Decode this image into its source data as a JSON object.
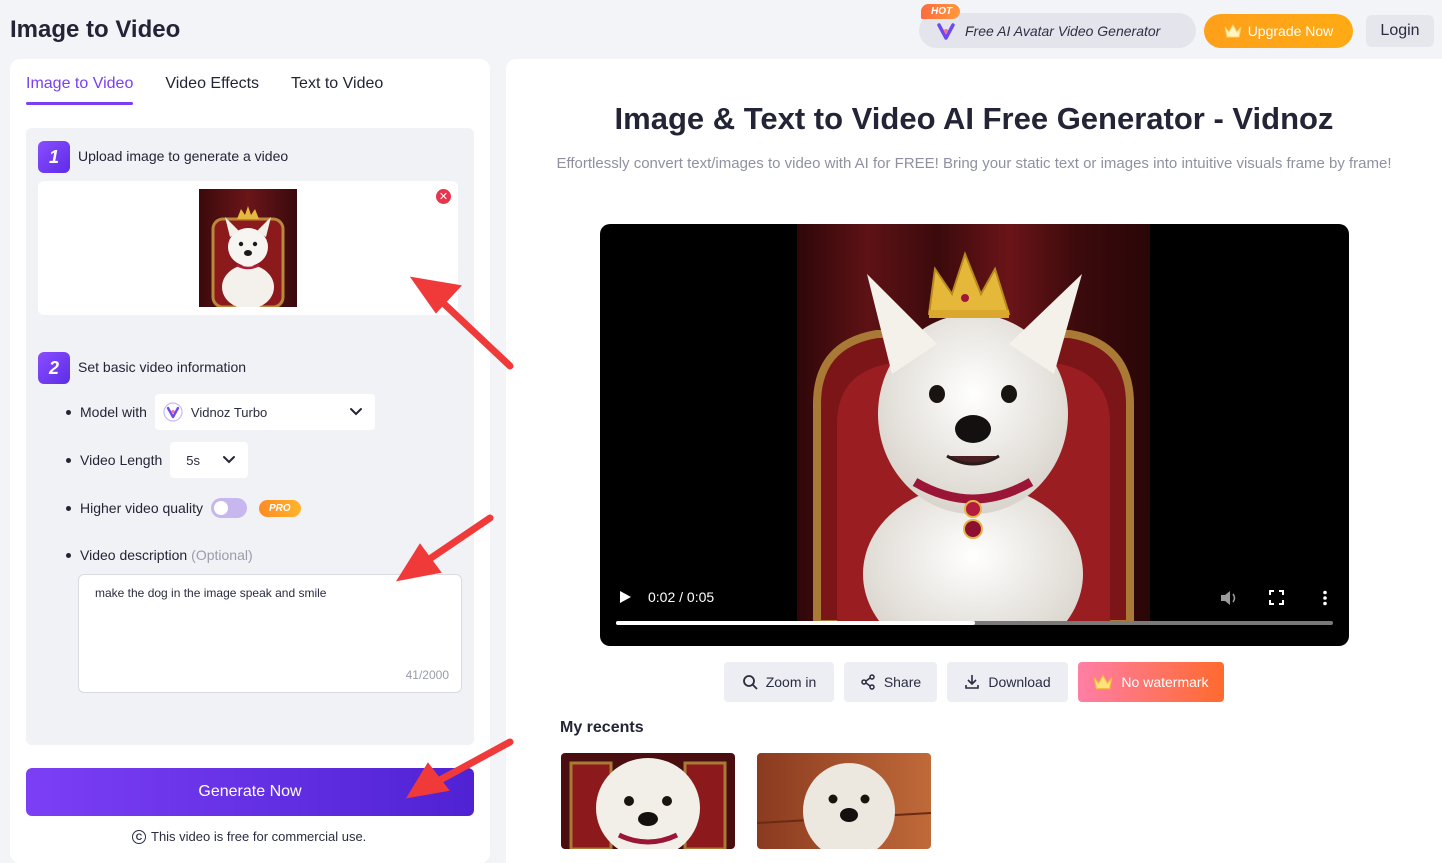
{
  "header": {
    "app_title": "Image to Video",
    "hot_badge": "HOT",
    "avatar_generator_label": "Free AI Avatar Video Generator",
    "upgrade_label": "Upgrade Now",
    "login_label": "Login"
  },
  "tabs": [
    {
      "label": "Image to Video",
      "active": true
    },
    {
      "label": "Video Effects",
      "active": false
    },
    {
      "label": "Text to Video",
      "active": false
    }
  ],
  "step1": {
    "number": "1",
    "label": "Upload image to generate a video"
  },
  "step2": {
    "number": "2",
    "label": "Set basic video information",
    "model_label": "Model with",
    "model_value": "Vidnoz Turbo",
    "length_label": "Video Length",
    "length_value": "5s",
    "quality_label": "Higher video quality",
    "quality_enabled": false,
    "pro_badge": "PRO",
    "description_label": "Video description",
    "description_optional": "(Optional)",
    "description_value": "make the dog in the image speak and smile",
    "description_count": "41/2000"
  },
  "generate_label": "Generate Now",
  "commercial_note": "This video is free for commercial use.",
  "main": {
    "title": "Image & Text to Video AI Free Generator - Vidnoz",
    "subtitle": "Effortlessly convert text/images to video with AI for FREE! Bring your static text or images into intuitive visuals frame by frame!"
  },
  "player": {
    "time": "0:02 / 0:05",
    "progress": 0.5
  },
  "actions": {
    "zoom": "Zoom in",
    "share": "Share",
    "download": "Download",
    "no_watermark": "No watermark"
  },
  "recents_title": "My recents",
  "colors": {
    "accent": "#7a3ff2",
    "upgrade": "#ffa317",
    "remove": "#e8344c"
  }
}
